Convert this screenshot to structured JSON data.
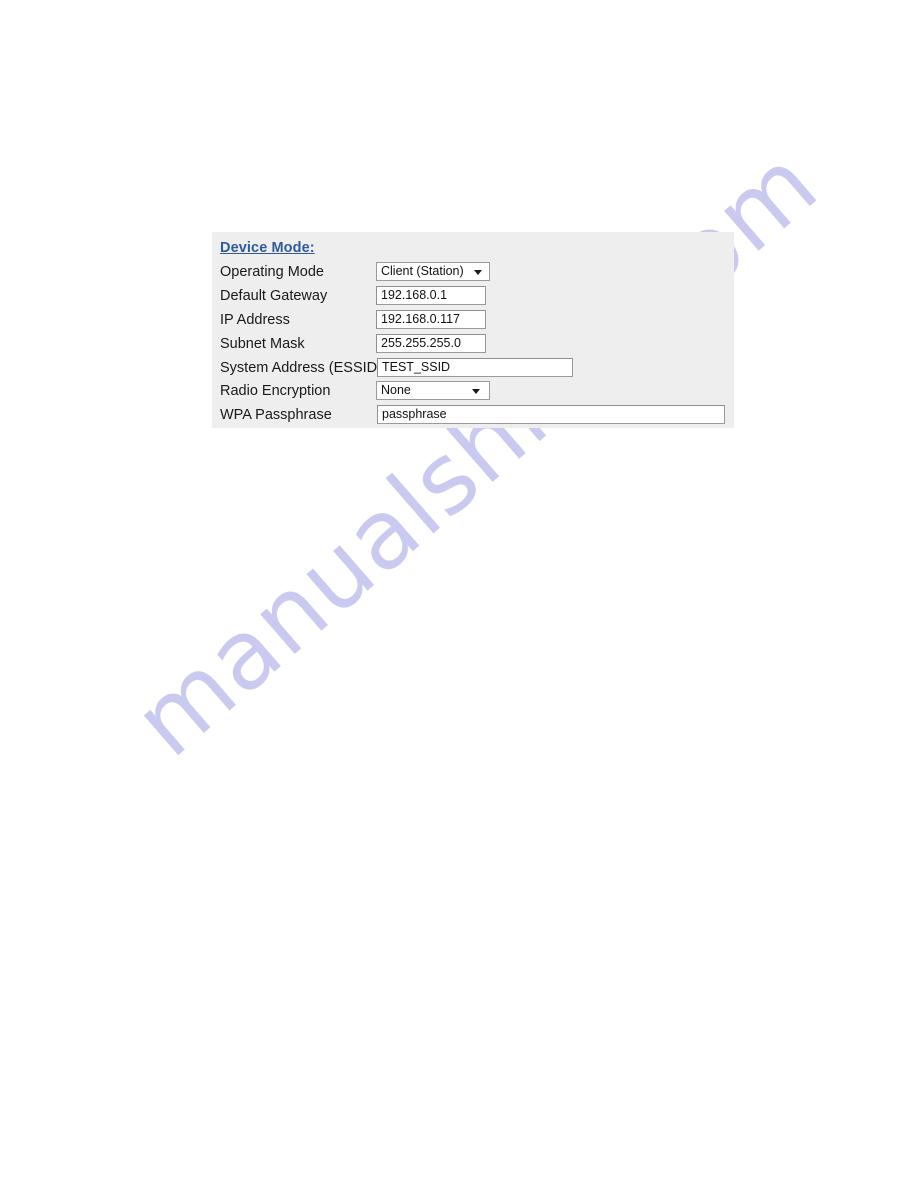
{
  "page": {
    "background_color": "#ffffff",
    "watermark": {
      "text": "manualshive.com",
      "color": "#c8c8f0"
    }
  },
  "panel": {
    "background_color": "#eeeeee",
    "heading": "Device Mode:",
    "heading_color": "#2f5b9a",
    "rows": [
      {
        "label": "Operating Mode",
        "control": "select",
        "value": "Client (Station)"
      },
      {
        "label": "Default Gateway",
        "control": "text",
        "value": "192.168.0.1"
      },
      {
        "label": "IP Address",
        "control": "text",
        "value": "192.168.0.117"
      },
      {
        "label": "Subnet Mask",
        "control": "text",
        "value": "255.255.255.0"
      },
      {
        "label": "System Address (ESSID)",
        "control": "text",
        "value": "TEST_SSID"
      },
      {
        "label": "Radio Encryption",
        "control": "select",
        "value": "None"
      },
      {
        "label": "WPA Passphrase",
        "control": "text",
        "value": "passphrase"
      }
    ]
  }
}
